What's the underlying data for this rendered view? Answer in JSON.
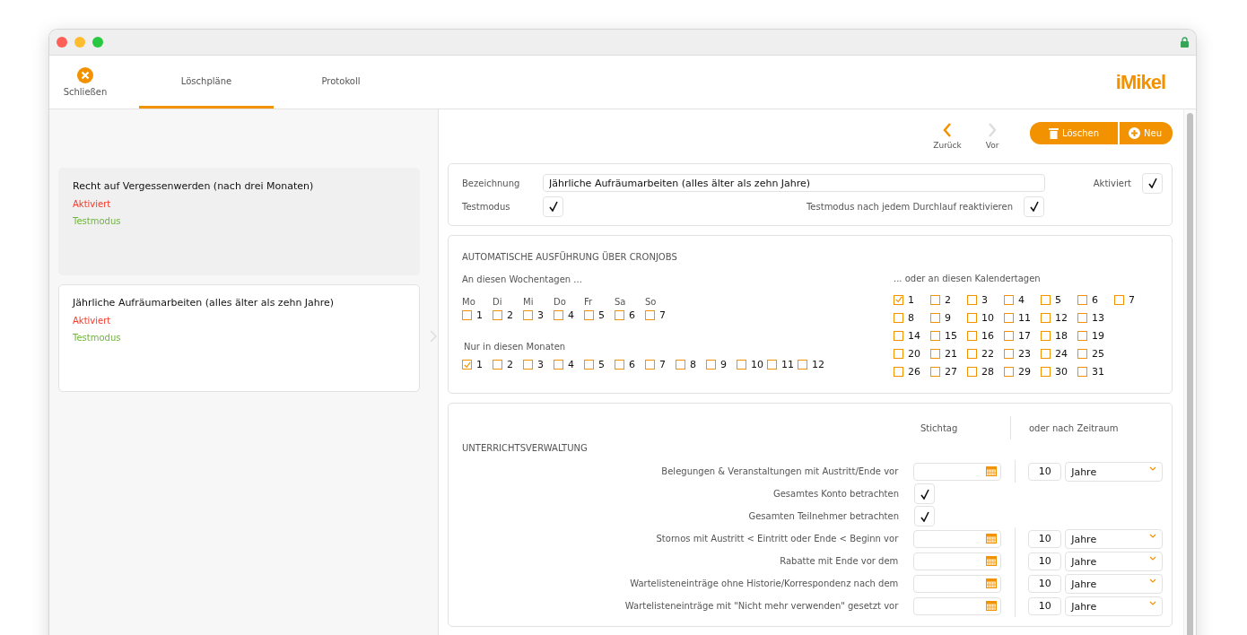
{
  "header": {
    "close_label": "Schließen",
    "tabs": [
      {
        "label": "Löschpläne",
        "selected": true
      },
      {
        "label": "Protokoll",
        "selected": false
      }
    ],
    "logo": "iMikel"
  },
  "plans": [
    {
      "title": "Recht auf Vergessenwerden (nach drei Monaten)",
      "status": "Aktiviert",
      "mode": "Testmodus",
      "selected": false
    },
    {
      "title": "Jährliche Aufräumarbeiten (alles älter als zehn Jahre)",
      "status": "Aktiviert",
      "mode": "Testmodus",
      "selected": true
    }
  ],
  "toolbar": {
    "back": "Zurück",
    "forward": "Vor",
    "forward_disabled": true,
    "delete": "Löschen",
    "new": "Neu"
  },
  "general": {
    "name_label": "Bezeichnung",
    "name_value": "Jährliche Aufräumarbeiten (alles älter als zehn Jahre)",
    "active_label": "Aktiviert",
    "active": true,
    "test_label": "Testmodus",
    "test": true,
    "reactivate_label": "Testmodus nach jedem Durchlauf reaktivieren",
    "reactivate": true
  },
  "cron": {
    "title": "AUTOMATISCHE AUSFÜHRUNG ÜBER CRONJOBS",
    "weekdays_label": "An diesen Wochentagen ...",
    "weekdays": [
      {
        "short": "Mo",
        "number": "1",
        "checked": false
      },
      {
        "short": "Di",
        "number": "2",
        "checked": false
      },
      {
        "short": "Mi",
        "number": "3",
        "checked": false
      },
      {
        "short": "Do",
        "number": "4",
        "checked": false
      },
      {
        "short": "Fr",
        "number": "5",
        "checked": false
      },
      {
        "short": "Sa",
        "number": "6",
        "checked": false
      },
      {
        "short": "So",
        "number": "7",
        "checked": false
      }
    ],
    "months_label": "Nur in diesen Monaten",
    "months": [
      {
        "number": "1",
        "checked": true
      },
      {
        "number": "2",
        "checked": false
      },
      {
        "number": "3",
        "checked": false
      },
      {
        "number": "4",
        "checked": false
      },
      {
        "number": "5",
        "checked": false
      },
      {
        "number": "6",
        "checked": false
      },
      {
        "number": "7",
        "checked": false
      },
      {
        "number": "8",
        "checked": false
      },
      {
        "number": "9",
        "checked": false
      },
      {
        "number": "10",
        "checked": false
      },
      {
        "number": "11",
        "checked": false
      },
      {
        "number": "12",
        "checked": false
      }
    ],
    "days_label": "... oder an diesen Kalendertagen",
    "day_rows": [
      [
        {
          "number": "1",
          "checked": true
        },
        {
          "number": "2",
          "checked": false
        },
        {
          "number": "3",
          "checked": false
        },
        {
          "number": "4",
          "checked": false
        },
        {
          "number": "5",
          "checked": false
        },
        {
          "number": "6",
          "checked": false
        },
        {
          "number": "7",
          "checked": false
        }
      ],
      [
        {
          "number": "8",
          "checked": false
        },
        {
          "number": "9",
          "checked": false
        },
        {
          "number": "10",
          "checked": false
        },
        {
          "number": "11",
          "checked": false
        },
        {
          "number": "12",
          "checked": false
        },
        {
          "number": "13",
          "checked": false
        }
      ],
      [
        {
          "number": "14",
          "checked": false
        },
        {
          "number": "15",
          "checked": false
        },
        {
          "number": "16",
          "checked": false
        },
        {
          "number": "17",
          "checked": false
        },
        {
          "number": "18",
          "checked": false
        },
        {
          "number": "19",
          "checked": false
        }
      ],
      [
        {
          "number": "20",
          "checked": false
        },
        {
          "number": "21",
          "checked": false
        },
        {
          "number": "22",
          "checked": false
        },
        {
          "number": "23",
          "checked": false
        },
        {
          "number": "24",
          "checked": false
        },
        {
          "number": "25",
          "checked": false
        }
      ],
      [
        {
          "number": "26",
          "checked": false
        },
        {
          "number": "27",
          "checked": false
        },
        {
          "number": "28",
          "checked": false
        },
        {
          "number": "29",
          "checked": false
        },
        {
          "number": "30",
          "checked": false
        },
        {
          "number": "31",
          "checked": false
        }
      ]
    ]
  },
  "rules": {
    "col_date": "Stichtag",
    "col_period": "oder nach Zeitraum",
    "section": "UNTERRICHTSVERWALTUNG",
    "rows": [
      {
        "kind": "period",
        "label": "Belegungen & Veranstaltungen mit Austritt/Ende vor",
        "amount": "10",
        "unit": "Jahre"
      },
      {
        "kind": "checkbox",
        "label": "Gesamtes Konto betrachten",
        "checked": true
      },
      {
        "kind": "checkbox",
        "label": "Gesamten Teilnehmer betrachten",
        "checked": true
      },
      {
        "kind": "period",
        "label": "Stornos mit Austritt < Eintritt oder Ende < Beginn vor",
        "amount": "10",
        "unit": "Jahre"
      },
      {
        "kind": "period",
        "label": "Rabatte mit Ende vor dem",
        "amount": "10",
        "unit": "Jahre"
      },
      {
        "kind": "period",
        "label": "Wartelisteneinträge ohne Historie/Korrespondenz nach dem",
        "amount": "10",
        "unit": "Jahre"
      },
      {
        "kind": "period",
        "label": "Wartelisteneinträge mit \"Nicht mehr verwenden\" gesetzt vor",
        "amount": "10",
        "unit": "Jahre"
      }
    ]
  }
}
